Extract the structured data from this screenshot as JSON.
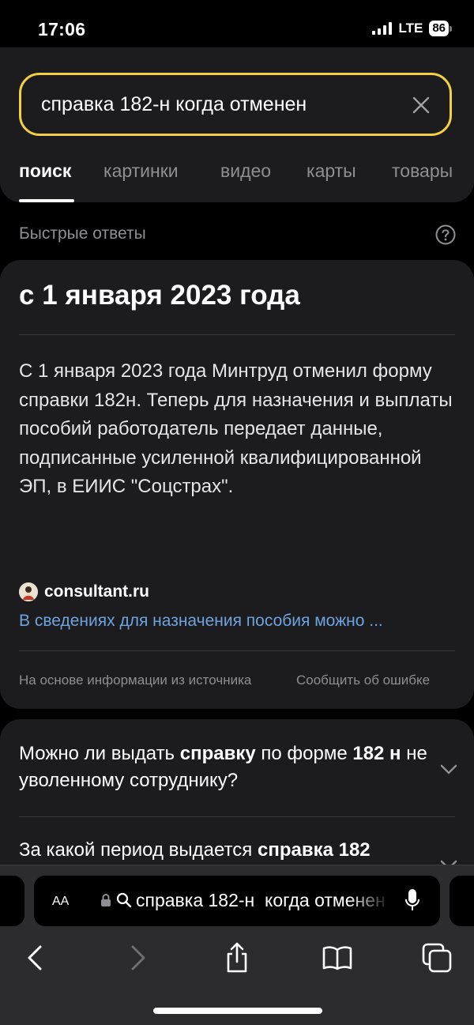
{
  "status_bar": {
    "time": "17:06",
    "network": "LTE",
    "battery": "86"
  },
  "search": {
    "query": "справка 182-н когда отменен"
  },
  "tabs": [
    {
      "label": "поиск",
      "active": true
    },
    {
      "label": "картинки",
      "active": false
    },
    {
      "label": "видео",
      "active": false
    },
    {
      "label": "карты",
      "active": false
    },
    {
      "label": "товары",
      "active": false
    }
  ],
  "quick_answers": {
    "label": "Быстрые ответы",
    "title": "с 1 января 2023 года",
    "text": "С 1 января 2023 года Минтруд отменил форму справки 182н. Теперь для назначения и выплаты пособий работодатель передает данные, подписанные усиленной квалифицированной ЭП, в ЕИИС \"Соцстрах\".",
    "source_name": "consultant.ru",
    "source_link": "В сведениях для назначения пособия можно ...",
    "based_on": "На основе информации из источника",
    "report_error": "Сообщить об ошибке"
  },
  "faq": {
    "q1_part1": "Можно ли выдать ",
    "q1_bold1": "справку",
    "q1_part2": " по форме ",
    "q1_bold2": "182 н",
    "q1_part3": " не уволенному сотруднику?",
    "q2_part1": "За какой период выдается ",
    "q2_bold1": "справка 182"
  },
  "browser": {
    "aa_label": "AA",
    "url_text": "справка 182-н  когда отменен"
  },
  "colors": {
    "accent_search_border": "#f3cf42",
    "link": "#6ea3de",
    "card": "#1c1c1e",
    "muted": "#8e8e93"
  }
}
